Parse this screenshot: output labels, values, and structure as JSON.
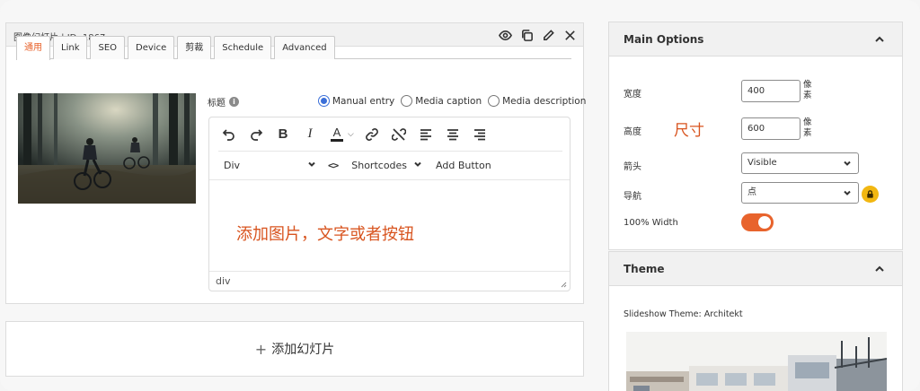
{
  "slide": {
    "title": "图像幻灯片 | ID: 1867",
    "tabs": [
      {
        "label": "通用",
        "active": true
      },
      {
        "label": "Link",
        "active": false
      },
      {
        "label": "SEO",
        "active": false
      },
      {
        "label": "Device",
        "active": false
      },
      {
        "label": "剪裁",
        "active": false
      },
      {
        "label": "Schedule",
        "active": false
      },
      {
        "label": "Advanced",
        "active": false
      }
    ],
    "caption_label": "标题",
    "caption_modes": [
      {
        "label": "Manual entry",
        "checked": true
      },
      {
        "label": "Media caption",
        "checked": false
      },
      {
        "label": "Media description",
        "checked": false
      }
    ],
    "editor": {
      "format_value": "Div",
      "shortcodes_label": "Shortcodes",
      "add_button_label": "Add Button",
      "body_text": "添加图片，文字或者按钮",
      "status_path": "div"
    }
  },
  "add_slide_label": "添加幻灯片",
  "main_options": {
    "title": "Main Options",
    "width_label": "宽度",
    "width_value": "400",
    "height_label": "高度",
    "height_value": "600",
    "unit": "像素",
    "size_annotation": "尺寸",
    "arrows_label": "箭头",
    "arrows_value": "Visible",
    "navigation_label": "导航",
    "navigation_value": "点",
    "full_width_label": "100% Width",
    "full_width_on": true
  },
  "theme": {
    "title": "Theme",
    "label": "Slideshow Theme: Architekt"
  },
  "colors": {
    "accent": "#e8632c",
    "annotation": "#d8541f",
    "lock": "#f2b711",
    "radio": "#3b6fd8"
  },
  "icons": {
    "header": [
      "eye-icon",
      "duplicate-icon",
      "edit-icon",
      "close-icon"
    ],
    "toolbar": [
      "undo-icon",
      "redo-icon",
      "bold-icon",
      "italic-icon",
      "font-color-icon",
      "link-icon",
      "unlink-icon",
      "align-left-icon",
      "align-center-icon",
      "align-right-icon"
    ]
  }
}
